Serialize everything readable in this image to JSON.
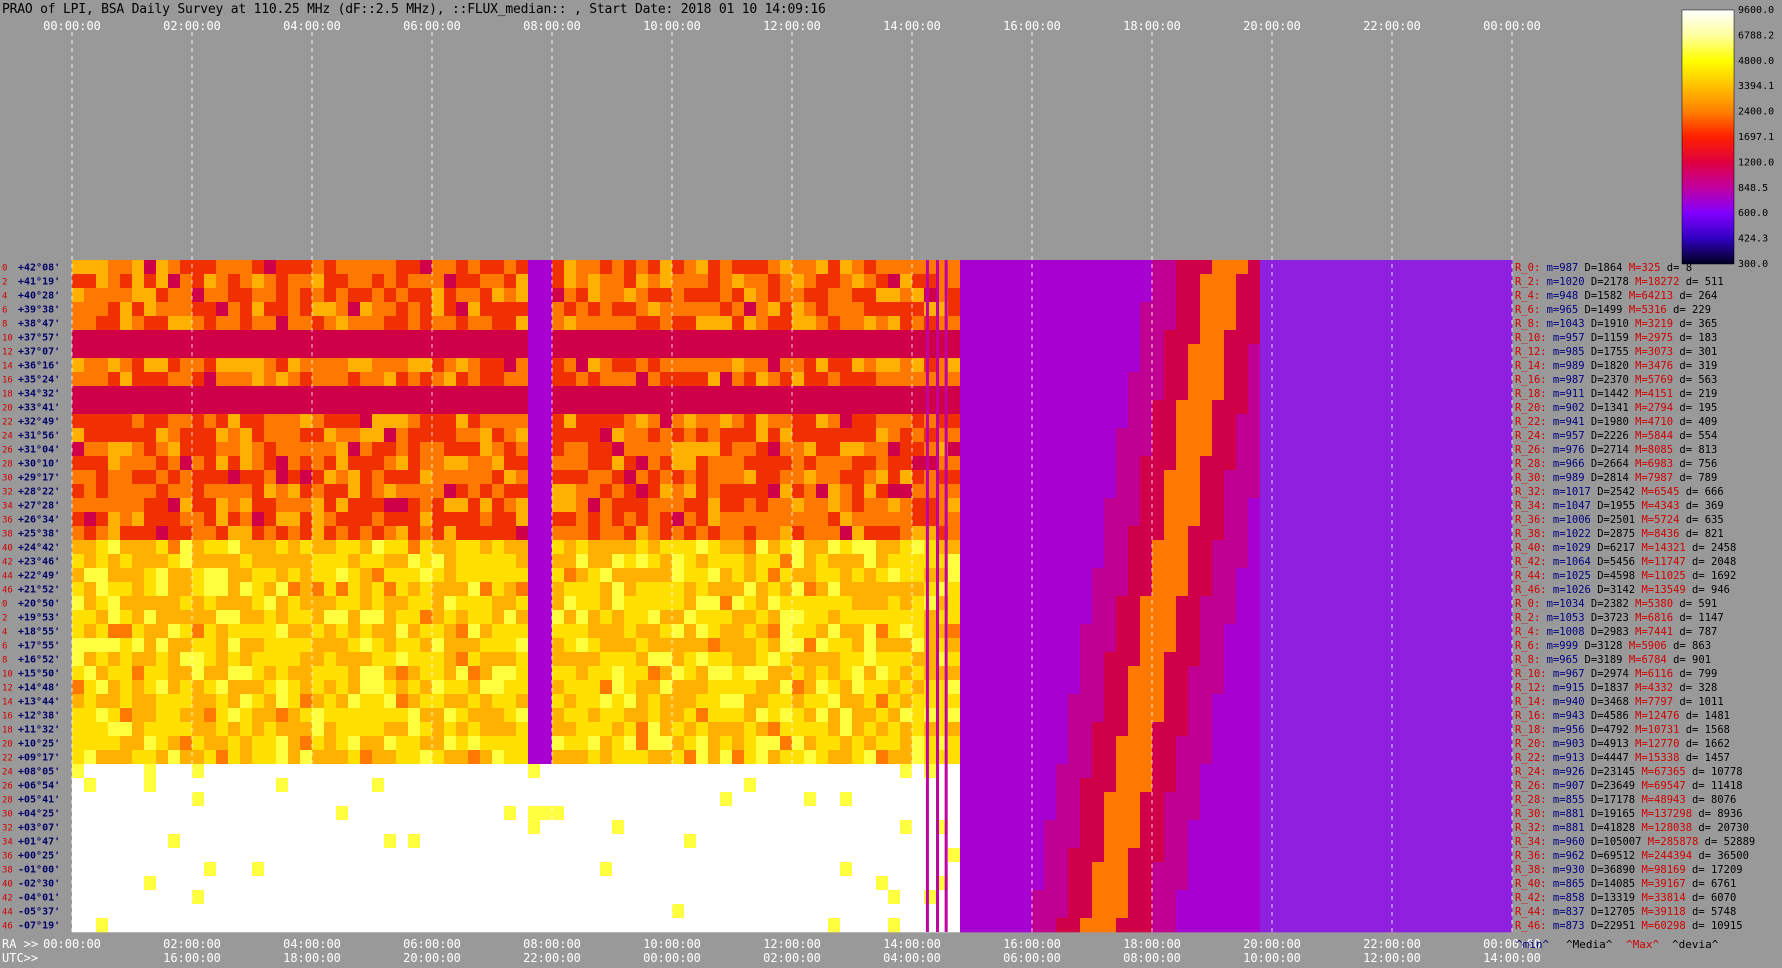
{
  "title": "PRAO of LPI, BSA Daily Survey at 110.25 MHz (dF::2.5 MHz), ::FLUX_median:: , Start Date: 2018 01 10 14:09:16",
  "axis": {
    "top_ticks": [
      "00:00:00",
      "02:00:00",
      "04:00:00",
      "06:00:00",
      "08:00:00",
      "10:00:00",
      "12:00:00",
      "14:00:00",
      "16:00:00",
      "18:00:00",
      "20:00:00",
      "22:00:00",
      "00:00:00"
    ],
    "ra_label": "RA >>",
    "ra_ticks": [
      "00:00:00",
      "02:00:00",
      "04:00:00",
      "06:00:00",
      "08:00:00",
      "10:00:00",
      "12:00:00",
      "14:00:00",
      "16:00:00",
      "18:00:00",
      "20:00:00",
      "22:00:00",
      "00:00:00"
    ],
    "utc_label": "UTC>>",
    "utc_ticks": [
      "16:00:00",
      "18:00:00",
      "20:00:00",
      "22:00:00",
      "00:00:00",
      "02:00:00",
      "04:00:00",
      "06:00:00",
      "08:00:00",
      "10:00:00",
      "12:00:00",
      "14:00:00"
    ]
  },
  "declinations": [
    "+42°08'",
    "+41°19'",
    "+40°28'",
    "+39°38'",
    "+38°47'",
    "+37°57'",
    "+37°07'",
    "+36°16'",
    "+35°24'",
    "+34°32'",
    "+33°41'",
    "+32°49'",
    "+31°56'",
    "+31°04'",
    "+30°10'",
    "+29°17'",
    "+28°22'",
    "+27°28'",
    "+26°34'",
    "+25°38'",
    "+24°42'",
    "+23°46'",
    "+22°49'",
    "+21°52'",
    "+20°50'",
    "+19°53'",
    "+18°55'",
    "+17°55'",
    "+16°52'",
    "+15°50'",
    "+14°48'",
    "+13°44'",
    "+12°38'",
    "+11°32'",
    "+10°25'",
    "+09°17'",
    "+08°05'",
    "+06°54'",
    "+05°41'",
    "+04°25'",
    "+03°07'",
    "+01°47'",
    "+00°25'",
    "-01°00'",
    "-02°30'",
    "-04°01'",
    "-05°37'",
    "-07°19'"
  ],
  "row_indices": [
    "0",
    "2",
    "4",
    "6",
    "8",
    "10",
    "12",
    "14",
    "16",
    "18",
    "20",
    "22",
    "24",
    "26",
    "28",
    "30",
    "32",
    "34",
    "36",
    "38",
    "40",
    "42",
    "44",
    "46",
    "0",
    "2",
    "4",
    "6",
    "8",
    "10",
    "12",
    "14",
    "16",
    "18",
    "20",
    "22",
    "24",
    "26",
    "28",
    "30",
    "32",
    "34",
    "36",
    "38",
    "40",
    "42",
    "44",
    "46"
  ],
  "stats": [
    {
      "r": "R_0:",
      "m": "m=987",
      "D": "D=1864",
      "M": "M=325",
      "d": "d= 8"
    },
    {
      "r": "R_2:",
      "m": "m=1020",
      "D": "D=2178",
      "M": "M=18272",
      "d": "d= 511"
    },
    {
      "r": "R_4:",
      "m": "m=948",
      "D": "D=1582",
      "M": "M=64213",
      "d": "d= 264"
    },
    {
      "r": "R_6:",
      "m": "m=965",
      "D": "D=1499",
      "M": "M=5316",
      "d": "d= 229"
    },
    {
      "r": "R_8:",
      "m": "m=1043",
      "D": "D=1910",
      "M": "M=3219",
      "d": "d= 365"
    },
    {
      "r": "R_10:",
      "m": "m=957",
      "D": "D=1159",
      "M": "M=2975",
      "d": "d= 183"
    },
    {
      "r": "R_12:",
      "m": "m=985",
      "D": "D=1755",
      "M": "M=3073",
      "d": "d= 301"
    },
    {
      "r": "R_14:",
      "m": "m=989",
      "D": "D=1820",
      "M": "M=3476",
      "d": "d= 319"
    },
    {
      "r": "R_16:",
      "m": "m=987",
      "D": "D=2370",
      "M": "M=5769",
      "d": "d= 563"
    },
    {
      "r": "R_18:",
      "m": "m=911",
      "D": "D=1442",
      "M": "M=4151",
      "d": "d= 219"
    },
    {
      "r": "R_20:",
      "m": "m=902",
      "D": "D=1341",
      "M": "M=2794",
      "d": "d= 195"
    },
    {
      "r": "R_22:",
      "m": "m=941",
      "D": "D=1980",
      "M": "M=4710",
      "d": "d= 409"
    },
    {
      "r": "R_24:",
      "m": "m=957",
      "D": "D=2226",
      "M": "M=5844",
      "d": "d= 554"
    },
    {
      "r": "R_26:",
      "m": "m=976",
      "D": "D=2714",
      "M": "M=8085",
      "d": "d= 813"
    },
    {
      "r": "R_28:",
      "m": "m=966",
      "D": "D=2664",
      "M": "M=6983",
      "d": "d= 756"
    },
    {
      "r": "R_30:",
      "m": "m=989",
      "D": "D=2814",
      "M": "M=7987",
      "d": "d= 789"
    },
    {
      "r": "R_32:",
      "m": "m=1017",
      "D": "D=2542",
      "M": "M=6545",
      "d": "d= 666"
    },
    {
      "r": "R_34:",
      "m": "m=1047",
      "D": "D=1955",
      "M": "M=4343",
      "d": "d= 369"
    },
    {
      "r": "R_36:",
      "m": "m=1006",
      "D": "D=2501",
      "M": "M=5724",
      "d": "d= 635"
    },
    {
      "r": "R_38:",
      "m": "m=1022",
      "D": "D=2875",
      "M": "M=8436",
      "d": "d= 821"
    },
    {
      "r": "R_40:",
      "m": "m=1029",
      "D": "D=6217",
      "M": "M=14321",
      "d": "d= 2458"
    },
    {
      "r": "R_42:",
      "m": "m=1064",
      "D": "D=5456",
      "M": "M=11747",
      "d": "d= 2048"
    },
    {
      "r": "R_44:",
      "m": "m=1025",
      "D": "D=4598",
      "M": "M=11025",
      "d": "d= 1692"
    },
    {
      "r": "R_46:",
      "m": "m=1026",
      "D": "D=3142",
      "M": "M=13549",
      "d": "d= 946"
    },
    {
      "r": "R_0:",
      "m": "m=1034",
      "D": "D=2382",
      "M": "M=5380",
      "d": "d= 591"
    },
    {
      "r": "R_2:",
      "m": "m=1053",
      "D": "D=3723",
      "M": "M=6816",
      "d": "d= 1147"
    },
    {
      "r": "R_4:",
      "m": "m=1008",
      "D": "D=2983",
      "M": "M=7441",
      "d": "d= 787"
    },
    {
      "r": "R_6:",
      "m": "m=999",
      "D": "D=3128",
      "M": "M=5906",
      "d": "d= 863"
    },
    {
      "r": "R_8:",
      "m": "m=965",
      "D": "D=3189",
      "M": "M=6784",
      "d": "d= 901"
    },
    {
      "r": "R_10:",
      "m": "m=967",
      "D": "D=2974",
      "M": "M=6116",
      "d": "d= 799"
    },
    {
      "r": "R_12:",
      "m": "m=915",
      "D": "D=1837",
      "M": "M=4332",
      "d": "d= 328"
    },
    {
      "r": "R_14:",
      "m": "m=940",
      "D": "D=3468",
      "M": "M=7797",
      "d": "d= 1011"
    },
    {
      "r": "R_16:",
      "m": "m=943",
      "D": "D=4586",
      "M": "M=12476",
      "d": "d= 1481"
    },
    {
      "r": "R_18:",
      "m": "m=956",
      "D": "D=4792",
      "M": "M=10731",
      "d": "d= 1568"
    },
    {
      "r": "R_20:",
      "m": "m=903",
      "D": "D=4913",
      "M": "M=12770",
      "d": "d= 1662"
    },
    {
      "r": "R_22:",
      "m": "m=913",
      "D": "D=4447",
      "M": "M=15338",
      "d": "d= 1457"
    },
    {
      "r": "R_24:",
      "m": "m=926",
      "D": "D=23145",
      "M": "M=67365",
      "d": "d= 10778"
    },
    {
      "r": "R_26:",
      "m": "m=907",
      "D": "D=23649",
      "M": "M=69547",
      "d": "d= 11418"
    },
    {
      "r": "R_28:",
      "m": "m=855",
      "D": "D=17178",
      "M": "M=48943",
      "d": "d= 8076"
    },
    {
      "r": "R_30:",
      "m": "m=881",
      "D": "D=19165",
      "M": "M=137298",
      "d": "d= 8936"
    },
    {
      "r": "R_32:",
      "m": "m=881",
      "D": "D=41828",
      "M": "M=128038",
      "d": "d= 20730"
    },
    {
      "r": "R_34:",
      "m": "m=960",
      "D": "D=105007",
      "M": "M=285878",
      "d": "d= 52889"
    },
    {
      "r": "R_36:",
      "m": "m=962",
      "D": "D=69512",
      "M": "M=244394",
      "d": "d= 36500"
    },
    {
      "r": "R_38:",
      "m": "m=930",
      "D": "D=36890",
      "M": "M=98169",
      "d": "d= 17209"
    },
    {
      "r": "R_40:",
      "m": "m=865",
      "D": "D=14085",
      "M": "M=39167",
      "d": "d= 6761"
    },
    {
      "r": "R_42:",
      "m": "m=858",
      "D": "D=13319",
      "M": "M=33814",
      "d": "d= 6070"
    },
    {
      "r": "R_44:",
      "m": "m=837",
      "D": "D=12705",
      "M": "M=39118",
      "d": "d= 5748"
    },
    {
      "r": "R_46:",
      "m": "m=873",
      "D": "D=22951",
      "M": "M=60298",
      "d": "d= 10915"
    }
  ],
  "stats_footer": {
    "min": "^min^",
    "media": "^Media^",
    "max": "^Max^",
    "devia": "^devia^"
  },
  "colorbar": {
    "labels": [
      "9600.0",
      "6788.2",
      "4800.0",
      "3394.1",
      "2400.0",
      "1697.1",
      "1200.0",
      "848.5",
      "600.0",
      "424.3",
      "300.0"
    ],
    "colors": [
      "#ffffff",
      "#ffffa0",
      "#ffff00",
      "#ffc000",
      "#ff8000",
      "#ff2000",
      "#e00040",
      "#c000a0",
      "#8000ff",
      "#3000c0",
      "#000020"
    ]
  },
  "chart_data": {
    "type": "heatmap",
    "title": "PRAO of LPI, BSA Daily Survey at 110.25 MHz (dF::2.5 MHz), ::FLUX_median:: , Start Date: 2018 01 10 14:09:16",
    "x_axis": "RA 00:00:00 – 00:00:00 (24 h)",
    "y_axis": "Declination +42°08' to -07°19'",
    "rows": 48,
    "color_scale": "log",
    "zlim": [
      300,
      9600
    ]
  }
}
